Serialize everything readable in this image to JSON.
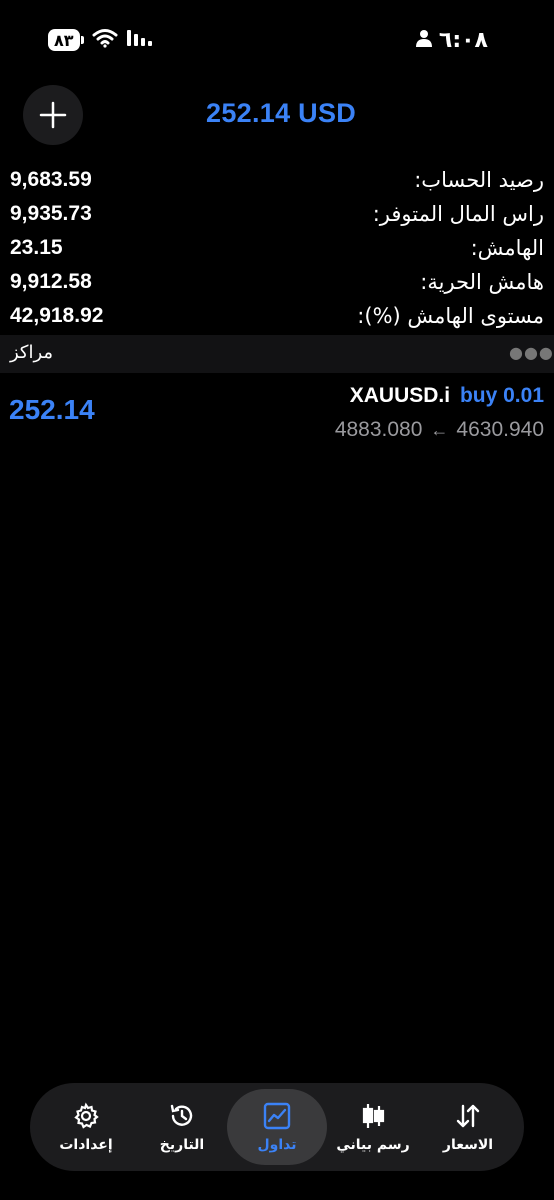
{
  "status_bar": {
    "battery": "٨٣",
    "time": "٦:٠٨"
  },
  "header": {
    "balance_title": "252.14 USD"
  },
  "account_summary": [
    {
      "label": "رصيد الحساب:",
      "value": "9,683.59"
    },
    {
      "label": "راس المال المتوفر:",
      "value": "9,935.73"
    },
    {
      "label": "الهامش:",
      "value": "23.15"
    },
    {
      "label": "هامش الحرية:",
      "value": "9,912.58"
    },
    {
      "label": "مستوى الهامش (%):",
      "value": "42,918.92"
    }
  ],
  "positions": {
    "title": "مراكز",
    "items": [
      {
        "symbol": "XAUUSD.i",
        "side": "buy 0.01",
        "open_price": "4630.940",
        "current_price": "4883.080",
        "arrow": "←",
        "profit": "252.14"
      }
    ]
  },
  "bottom_nav": {
    "items": [
      {
        "label": "إعدادات",
        "icon": "gear-icon"
      },
      {
        "label": "التاريخ",
        "icon": "history-icon"
      },
      {
        "label": "تداول",
        "icon": "trade-chart-icon",
        "active": true
      },
      {
        "label": "رسم بياني",
        "icon": "candlestick-icon"
      },
      {
        "label": "الاسعار",
        "icon": "sort-arrows-icon"
      }
    ]
  },
  "colors": {
    "accent": "#3b82f6",
    "background": "#000000",
    "panel": "#1c1c1e"
  }
}
